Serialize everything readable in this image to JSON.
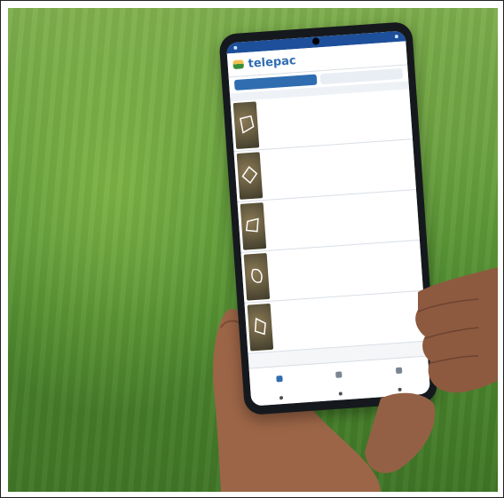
{
  "photo": {
    "description_colors": {
      "grass": "#5f9a3a",
      "skin": "#a06a4d",
      "phone_body": "#15191d",
      "accent": "#2f6db0"
    }
  },
  "app": {
    "brand": "telepac",
    "tabs": [
      {
        "label": "",
        "active": true
      },
      {
        "label": "",
        "active": false
      }
    ],
    "rows": [
      {
        "title": "",
        "subtitle": "",
        "badge": ""
      },
      {
        "title": "",
        "subtitle": "",
        "badge": ""
      },
      {
        "title": "",
        "subtitle": "",
        "badge": ""
      },
      {
        "title": "",
        "subtitle": "",
        "badge": ""
      },
      {
        "title": "",
        "subtitle": "",
        "badge": ""
      }
    ],
    "navbar": [
      {
        "icon": "list-icon",
        "label": "",
        "active": true
      },
      {
        "icon": "map-icon",
        "label": "",
        "active": false
      },
      {
        "icon": "menu-icon",
        "label": "",
        "active": false
      }
    ]
  }
}
